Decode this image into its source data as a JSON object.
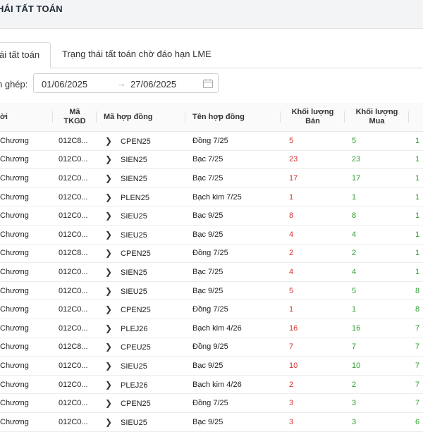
{
  "header": {
    "title": "HÁI TẤT TOÁN"
  },
  "tabs": [
    {
      "label": "ái tất toán",
      "active": true
    },
    {
      "label": "Trạng thái tất toán chờ đáo hạn LME",
      "active": false
    }
  ],
  "filter": {
    "label": "n ghép:",
    "date_from": "01/06/2025",
    "arrow": "→",
    "date_to": "27/06/2025"
  },
  "table": {
    "columns": {
      "name": "ời",
      "tkgd_line1": "Mã",
      "tkgd_line2": "TKGD",
      "ma": "Mã hợp đồng",
      "ten": "Tên hợp đồng",
      "ban_line1": "Khối lượng",
      "ban_line2": "Bán",
      "mua_line1": "Khối lượng",
      "mua_line2": "Mua"
    },
    "rows": [
      {
        "name": "Chương",
        "tkgd": "012C8...",
        "ma": "CPEN25",
        "ten": "Đồng 7/25",
        "ban": "5",
        "mua": "5",
        "last": "1"
      },
      {
        "name": "Chương",
        "tkgd": "012C0...",
        "ma": "SIEN25",
        "ten": "Bạc 7/25",
        "ban": "23",
        "mua": "23",
        "last": "1"
      },
      {
        "name": "Chương",
        "tkgd": "012C0...",
        "ma": "SIEN25",
        "ten": "Bạc 7/25",
        "ban": "17",
        "mua": "17",
        "last": "1"
      },
      {
        "name": "Chương",
        "tkgd": "012C0...",
        "ma": "PLEN25",
        "ten": "Bạch kim 7/25",
        "ban": "1",
        "mua": "1",
        "last": "1"
      },
      {
        "name": "Chương",
        "tkgd": "012C0...",
        "ma": "SIEU25",
        "ten": "Bạc 9/25",
        "ban": "8",
        "mua": "8",
        "last": "1"
      },
      {
        "name": "Chương",
        "tkgd": "012C0...",
        "ma": "SIEU25",
        "ten": "Bạc 9/25",
        "ban": "4",
        "mua": "4",
        "last": "1"
      },
      {
        "name": "Chương",
        "tkgd": "012C8...",
        "ma": "CPEN25",
        "ten": "Đồng 7/25",
        "ban": "2",
        "mua": "2",
        "last": "1"
      },
      {
        "name": "Chương",
        "tkgd": "012C0...",
        "ma": "SIEN25",
        "ten": "Bạc 7/25",
        "ban": "4",
        "mua": "4",
        "last": "1"
      },
      {
        "name": "Chương",
        "tkgd": "012C0...",
        "ma": "SIEU25",
        "ten": "Bạc 9/25",
        "ban": "5",
        "mua": "5",
        "last": "8"
      },
      {
        "name": "Chương",
        "tkgd": "012C0...",
        "ma": "CPEN25",
        "ten": "Đồng 7/25",
        "ban": "1",
        "mua": "1",
        "last": "8"
      },
      {
        "name": "Chương",
        "tkgd": "012C0...",
        "ma": "PLEJ26",
        "ten": "Bạch kim 4/26",
        "ban": "16",
        "mua": "16",
        "last": "7"
      },
      {
        "name": "Chương",
        "tkgd": "012C8...",
        "ma": "CPEU25",
        "ten": "Đồng 9/25",
        "ban": "7",
        "mua": "7",
        "last": "7"
      },
      {
        "name": "Chương",
        "tkgd": "012C0...",
        "ma": "SIEU25",
        "ten": "Bạc 9/25",
        "ban": "10",
        "mua": "10",
        "last": "7"
      },
      {
        "name": "Chương",
        "tkgd": "012C0...",
        "ma": "PLEJ26",
        "ten": "Bạch kim 4/26",
        "ban": "2",
        "mua": "2",
        "last": "7"
      },
      {
        "name": "Chương",
        "tkgd": "012C0...",
        "ma": "CPEN25",
        "ten": "Đồng 7/25",
        "ban": "3",
        "mua": "3",
        "last": "7"
      },
      {
        "name": "Chương",
        "tkgd": "012C0...",
        "ma": "SIEU25",
        "ten": "Bạc 9/25",
        "ban": "3",
        "mua": "3",
        "last": "6"
      }
    ]
  },
  "colors": {
    "sell": "#d32f2f",
    "buy": "#2e9e2e",
    "header_bg": "#f3f4f6"
  },
  "icons": {
    "expand": "chevron-right-icon",
    "calendar": "calendar-icon"
  }
}
